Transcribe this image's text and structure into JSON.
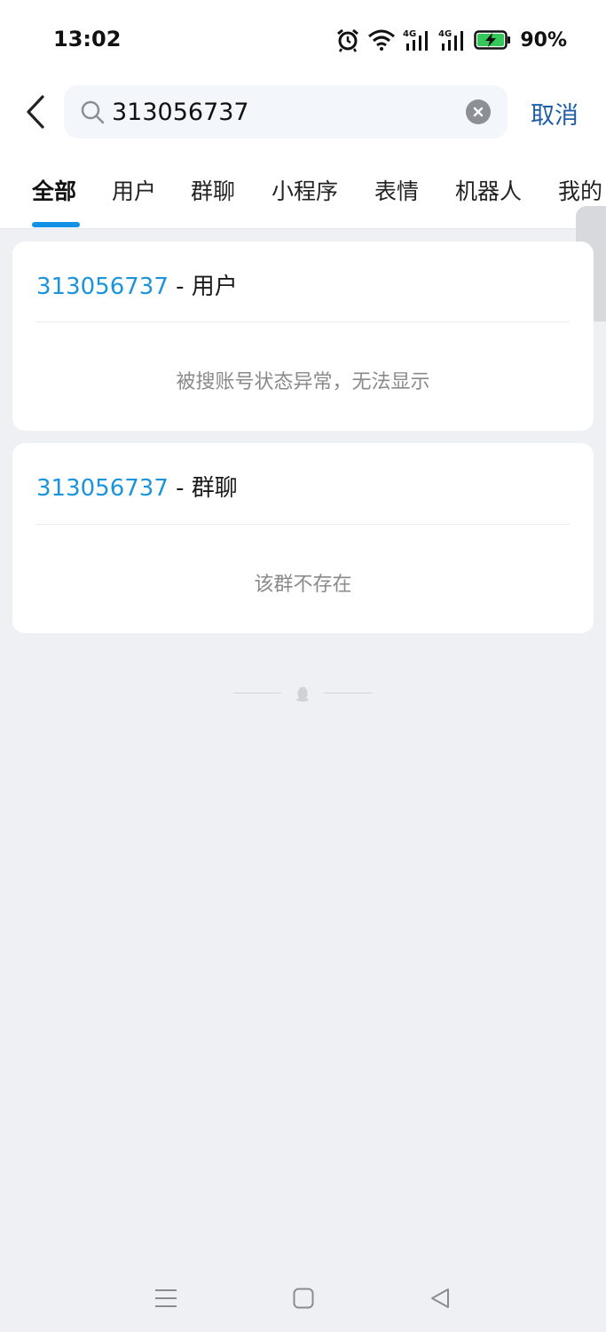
{
  "status_bar": {
    "time": "13:02",
    "battery": "90%",
    "icons": [
      "alarm-icon",
      "wifi-icon",
      "signal-4g-icon",
      "signal-4g-icon",
      "battery-charging-icon"
    ]
  },
  "search": {
    "value": "313056737",
    "cancel_label": "取消"
  },
  "tabs": [
    {
      "label": "全部",
      "active": true
    },
    {
      "label": "用户",
      "active": false
    },
    {
      "label": "群聊",
      "active": false
    },
    {
      "label": "小程序",
      "active": false
    },
    {
      "label": "表情",
      "active": false
    },
    {
      "label": "机器人",
      "active": false
    },
    {
      "label": "我的",
      "active": false
    }
  ],
  "results": [
    {
      "id": "313056737",
      "type": " - 用户",
      "message": "被搜账号状态异常，无法显示"
    },
    {
      "id": "313056737",
      "type": " - 群聊",
      "message": "该群不存在"
    }
  ],
  "colors": {
    "accent": "#1291e6",
    "link": "#1b94dc",
    "cancel": "#1f5ea8",
    "background": "#eff0f3"
  }
}
